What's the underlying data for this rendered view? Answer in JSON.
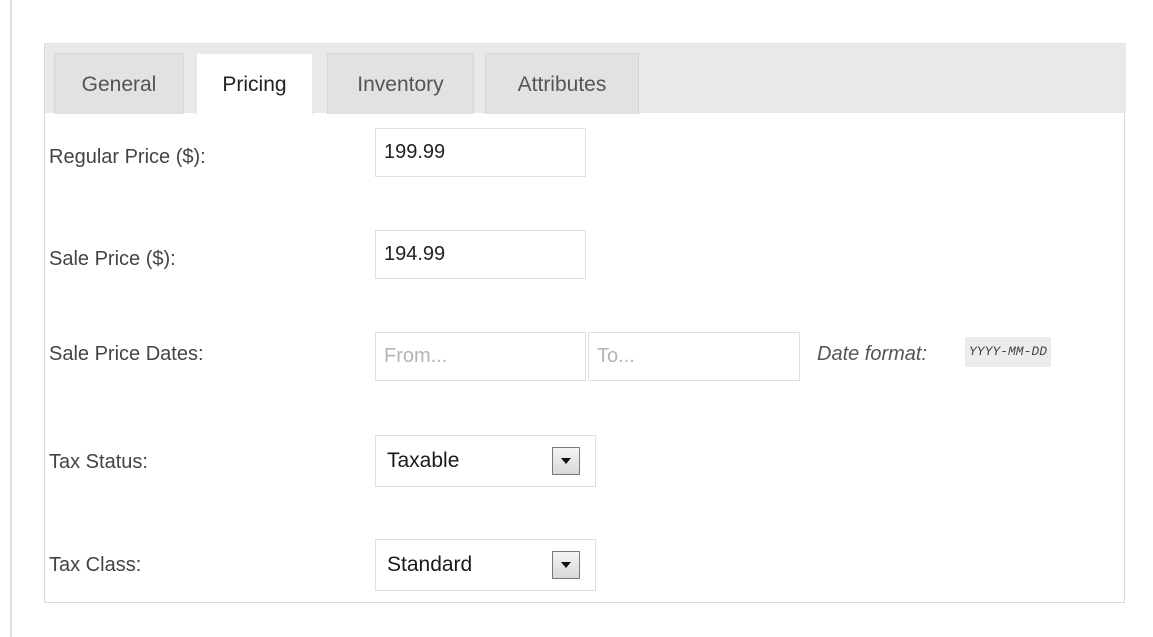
{
  "tabs": [
    {
      "label": "General",
      "active": false
    },
    {
      "label": "Pricing",
      "active": true
    },
    {
      "label": "Inventory",
      "active": false
    },
    {
      "label": "Attributes",
      "active": false
    }
  ],
  "fields": {
    "regular_price": {
      "label": "Regular Price ($):",
      "value": "199.99"
    },
    "sale_price": {
      "label": "Sale Price ($):",
      "value": "194.99"
    },
    "sale_dates": {
      "label": "Sale Price Dates:",
      "from_placeholder": "From...",
      "to_placeholder": "To...",
      "hint": "Date format:",
      "format": "YYYY-MM-DD"
    },
    "tax_status": {
      "label": "Tax Status:",
      "selected": "Taxable",
      "icon": "chevron-down-icon"
    },
    "tax_class": {
      "label": "Tax Class:",
      "selected": "Standard",
      "icon": "chevron-down-icon"
    }
  },
  "colors": {
    "tab_bar": "#e9e9e9",
    "tab_inactive": "#e2e2e2",
    "tab_active": "#ffffff",
    "border": "#d9d9d9"
  }
}
